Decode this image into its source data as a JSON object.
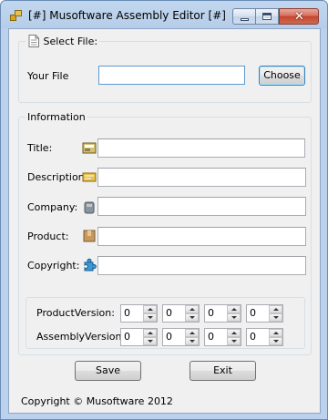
{
  "window": {
    "title": "[#] Musoftware Assembly Editor [#]",
    "minimize_icon": "minimize-icon",
    "maximize_icon": "maximize-icon",
    "close_glyph": "✕"
  },
  "select_file": {
    "title": "Select File:",
    "icon": "document-icon",
    "your_file_label": "Your File",
    "file_value": "",
    "choose_label": "Choose"
  },
  "information": {
    "title": "Information",
    "fields": [
      {
        "label": "Title:",
        "icon": "title-icon",
        "value": ""
      },
      {
        "label": "Description:",
        "icon": "description-icon",
        "value": ""
      },
      {
        "label": "Company:",
        "icon": "company-icon",
        "value": ""
      },
      {
        "label": "Product:",
        "icon": "product-icon",
        "value": ""
      },
      {
        "label": "Copyright:",
        "icon": "copyright-icon",
        "value": ""
      }
    ]
  },
  "versions": {
    "product_label": "ProductVersion:",
    "assembly_label": "AssemblyVersion:",
    "product_values": [
      "0",
      "0",
      "0",
      "0"
    ],
    "assembly_values": [
      "0",
      "0",
      "0",
      "0"
    ]
  },
  "buttons": {
    "save_label": "Save",
    "exit_label": "Exit"
  },
  "footer": {
    "copyright_text": "Copyright © Musoftware 2012"
  }
}
